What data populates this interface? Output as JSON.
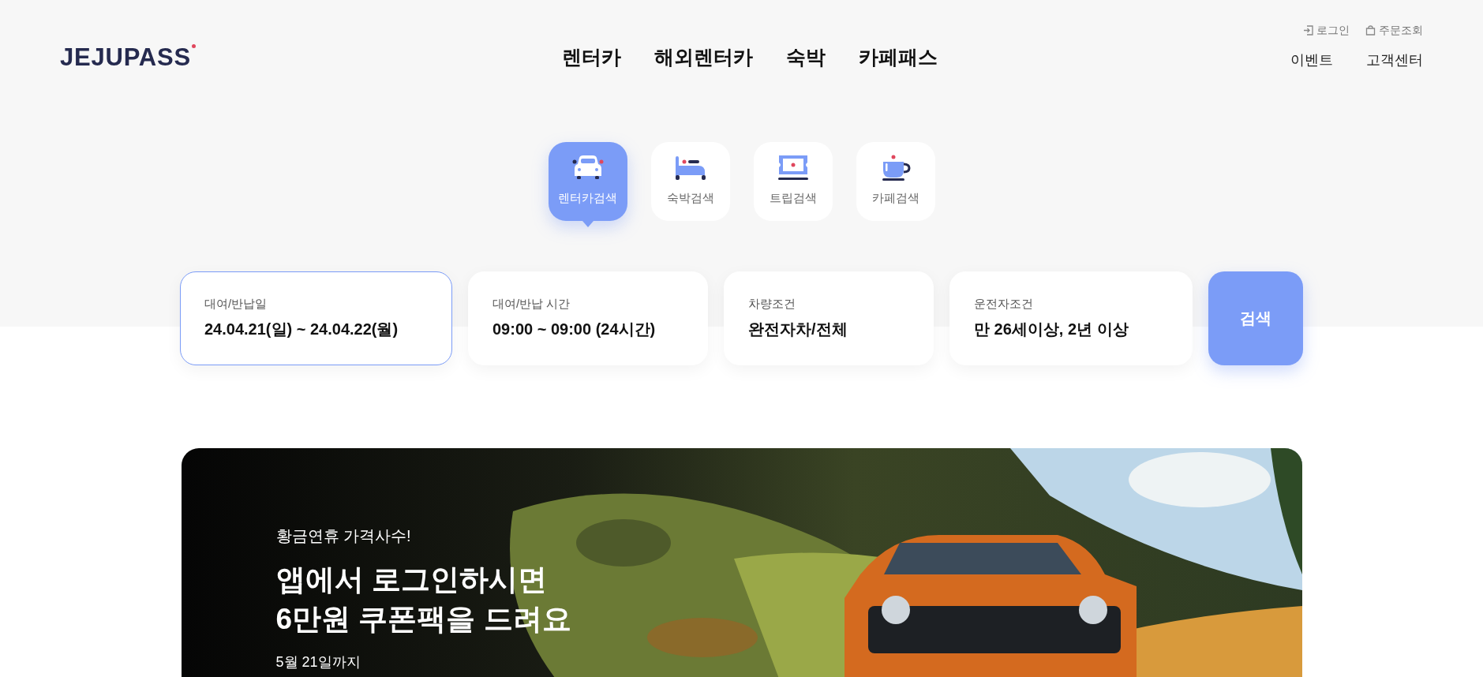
{
  "header": {
    "logo": "JEJUPASS",
    "nav": [
      "렌터카",
      "해외렌터카",
      "숙박",
      "카페패스"
    ],
    "utility_links": [
      {
        "kind": "login",
        "label": "로그인"
      },
      {
        "kind": "orders",
        "label": "주문조회"
      }
    ],
    "links": [
      "이벤트",
      "고객센터"
    ]
  },
  "search_tabs": [
    {
      "kind": "car",
      "label": "렌터카검색",
      "selected": true
    },
    {
      "kind": "bed",
      "label": "숙박검색",
      "selected": false
    },
    {
      "kind": "ticket",
      "label": "트립검색",
      "selected": false
    },
    {
      "kind": "cup",
      "label": "카페검색",
      "selected": false
    }
  ],
  "search_fields": [
    {
      "label": "대여/반납일",
      "value": "24.04.21(일) ~ 24.04.22(월)",
      "focused": true
    },
    {
      "label": "대여/반납 시간",
      "value": "09:00 ~ 09:00 (24시간)",
      "focused": false
    },
    {
      "label": "차량조건",
      "value": "완전자차/전체",
      "focused": false
    },
    {
      "label": "운전자조건",
      "value": "만 26세이상, 2년 이상",
      "focused": false
    }
  ],
  "search_button": "검색",
  "banner": {
    "kicker": "황금연휴 가격사수!",
    "headline": [
      "앱에서 로그인하시면",
      "6만원 쿠폰팩을 드려요"
    ],
    "note": "5월 21일까지"
  }
}
